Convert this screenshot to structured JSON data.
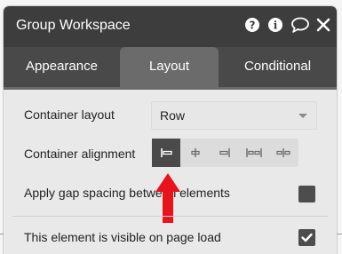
{
  "header": {
    "title": "Group Workspace",
    "icons": [
      "help-icon",
      "info-icon",
      "comment-icon",
      "close-icon"
    ]
  },
  "tabs": [
    {
      "label": "Appearance",
      "active": false
    },
    {
      "label": "Layout",
      "active": true
    },
    {
      "label": "Conditional",
      "active": false
    }
  ],
  "container_layout": {
    "label": "Container layout",
    "value": "Row"
  },
  "container_alignment": {
    "label": "Container alignment",
    "options": [
      "align-left-icon",
      "align-center-icon",
      "align-right-icon",
      "space-between-icon",
      "space-around-icon"
    ],
    "selected_index": 0
  },
  "gap_spacing": {
    "label": "Apply gap spacing between elements",
    "checked": false
  },
  "visible_on_load": {
    "label": "This element is visible on page load",
    "checked": true
  },
  "annotation": {
    "arrow_color": "#e8131b"
  },
  "colors": {
    "header": "#3d3d3d",
    "tabs": "#4a4a4a",
    "active_tab": "#6b6b6b",
    "panel": "#e9e9e9"
  }
}
